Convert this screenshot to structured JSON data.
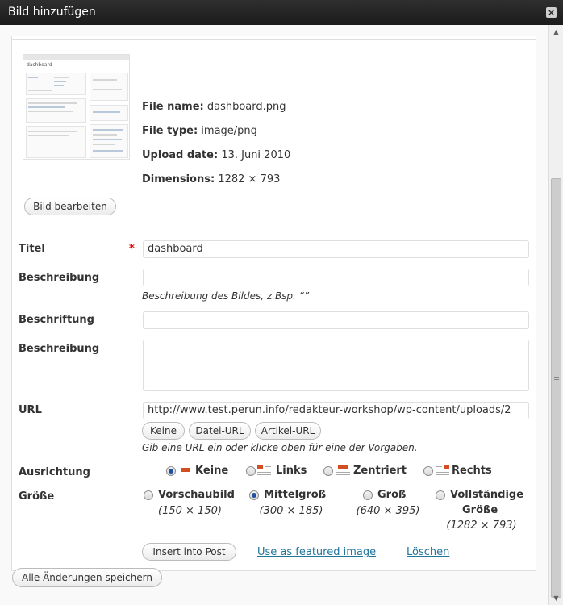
{
  "window": {
    "title": "Bild hinzufügen",
    "close_glyph": "×"
  },
  "scrollbar": {
    "up_glyph": "▲",
    "down_glyph": "▼"
  },
  "thumbnail": {
    "caption": "dashboard"
  },
  "file_info": {
    "name_label": "File name:",
    "name_value": "dashboard.png",
    "type_label": "File type:",
    "type_value": "image/png",
    "date_label": "Upload date:",
    "date_value": "13. Juni 2010",
    "dim_label": "Dimensions:",
    "dim_value": "1282 × 793"
  },
  "edit_image_label": "Bild bearbeiten",
  "fields": {
    "title_label": "Titel",
    "required_mark": "*",
    "title_value": "dashboard",
    "alt_label": "Beschreibung",
    "alt_hint": "Beschreibung des Bildes, z.Bsp. “”",
    "caption_label": "Beschriftung",
    "description_label": "Beschreibung",
    "url_label": "URL",
    "url_value": "http://www.test.perun.info/redakteur-workshop/wp-content/uploads/2",
    "url_hint": "Gib eine URL ein oder klicke oben für eine der Vorgaben."
  },
  "url_buttons": {
    "none": "Keine",
    "file": "Datei-URL",
    "post": "Artikel-URL"
  },
  "alignment": {
    "label": "Ausrichtung",
    "selected": "none",
    "options": {
      "none": "Keine",
      "left": "Links",
      "center": "Zentriert",
      "right": "Rechts"
    }
  },
  "size": {
    "label": "Größe",
    "selected": "medium",
    "thumbnail": {
      "name": "Vorschaubild",
      "dim": "(150 × 150)"
    },
    "medium": {
      "name": "Mittelgroß",
      "dim": "(300 × 185)"
    },
    "large": {
      "name": "Groß",
      "dim": "(640 × 395)"
    },
    "full": {
      "name_line1": "Vollständige",
      "name_line2": "Größe",
      "dim": "(1282 × 793)"
    }
  },
  "actions": {
    "insert": "Insert into Post",
    "featured": "Use as featured image",
    "delete": "Löschen"
  },
  "save_all": "Alle Änderungen speichern",
  "colors": {
    "accent_link": "#21759b",
    "required": "#ee0000",
    "align_icon": "#d54e21"
  }
}
